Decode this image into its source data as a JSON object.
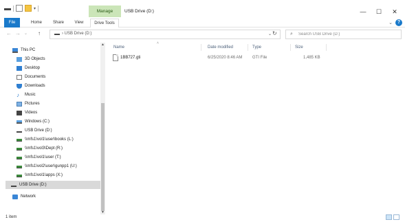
{
  "window": {
    "manage_tab": "Manage",
    "title": "USB Drive (D:)",
    "min_glyph": "—",
    "max_glyph": "☐",
    "close_glyph": "✕"
  },
  "ribbon": {
    "tabs": [
      "File",
      "Home",
      "Share",
      "View",
      "Drive Tools"
    ],
    "expand_glyph": "⌄",
    "help_glyph": "?"
  },
  "address": {
    "back_glyph": "←",
    "forward_glyph": "→",
    "recent_glyph": "⌄",
    "up_glyph": "↑",
    "crumb": "› USB Drive (D:)",
    "dropdown_glyph": "⌄",
    "refresh_glyph": "↻"
  },
  "search": {
    "icon_glyph": "⌕",
    "placeholder": "Search USB Drive (D:)"
  },
  "nav_pane": {
    "items": [
      {
        "label": "This PC",
        "icon": "pc-icon"
      },
      {
        "label": "3D Objects",
        "icon": "3d-objects-icon"
      },
      {
        "label": "Desktop",
        "icon": "desktop-icon"
      },
      {
        "label": "Documents",
        "icon": "documents-icon"
      },
      {
        "label": "Downloads",
        "icon": "downloads-icon"
      },
      {
        "label": "Music",
        "icon": "music-icon"
      },
      {
        "label": "Pictures",
        "icon": "pictures-icon"
      },
      {
        "label": "Videos",
        "icon": "videos-icon"
      },
      {
        "label": "Windows (C:)",
        "icon": "windows-drive-icon"
      },
      {
        "label": "USB Drive (D:)",
        "icon": "usb-drive-icon"
      },
      {
        "label": "\\\\mfs1\\vol1\\user\\books (L:)",
        "icon": "network-drive-icon"
      },
      {
        "label": "\\\\mfs1\\vol3\\Dept (R:)",
        "icon": "network-drive-icon"
      },
      {
        "label": "\\\\mfs1\\vol1\\user (T:)",
        "icon": "network-drive-icon"
      },
      {
        "label": "\\\\mfs1\\vol2\\user\\gunpp1 (U:)",
        "icon": "network-drive-icon"
      },
      {
        "label": "\\\\mfs1\\vol1\\apps (X:)",
        "icon": "network-drive-icon"
      },
      {
        "label": "USB Drive (D:)",
        "icon": "usb-drive-icon",
        "selected": true
      },
      {
        "label": "Network",
        "icon": "network-icon"
      }
    ],
    "scroll_up_glyph": "▲",
    "scroll_down_glyph": "▼"
  },
  "file_list": {
    "columns": {
      "name": "Name",
      "date_modified": "Date modified",
      "type": "Type",
      "size": "Size"
    },
    "sort_glyph": "˄",
    "rows": [
      {
        "name": "1BB727.gti",
        "date_modified": "6/25/2020 8:46 AM",
        "type": "GTI File",
        "size": "1,485 KB"
      }
    ]
  },
  "status_bar": {
    "item_count": "1 item"
  },
  "colors": {
    "accent": "#1979ca",
    "manage_tab_bg": "#cbe5b8",
    "selection": "#d9d9d9"
  }
}
